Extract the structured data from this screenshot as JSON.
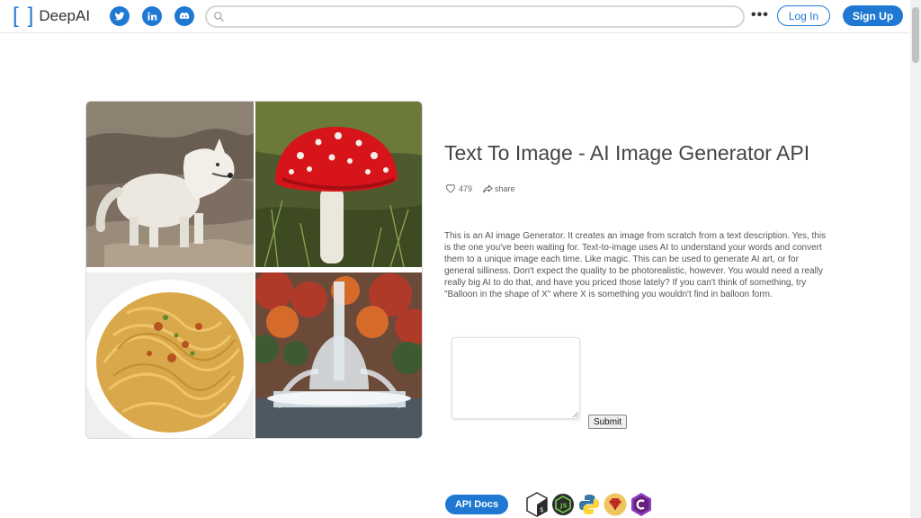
{
  "header": {
    "logo_text": "DeepAI",
    "search": {
      "placeholder": "",
      "value": ""
    },
    "more_label": "•••",
    "login_label": "Log In",
    "signup_label": "Sign Up",
    "social_icons": [
      "twitter-icon",
      "linkedin-icon",
      "discord-icon"
    ]
  },
  "gallery": {
    "images": [
      "white wolf on rocks",
      "red fly agaric mushroom",
      "spaghetti pasta dish",
      "water fountain with autumn trees"
    ]
  },
  "main": {
    "title": "Text To Image - AI Image Generator API",
    "likes": "479",
    "share_label": "share",
    "description": "This is an AI image Generator. It creates an image from scratch from a text description. Yes, this is the one you've been waiting for. Text-to-image uses AI to understand your words and convert them to a unique image each time. Like magic. This can be used to generate AI art, or for general silliness. Don't expect the quality to be photorealistic, however. You would need a really really big AI to do that, and have you priced those lately? If you can't think of something, try \"Balloon in the shape of X\" where X is something you wouldn't find in balloon form.",
    "prompt_value": "",
    "submit_label": "Submit"
  },
  "footer": {
    "api_docs_label": "API Docs",
    "language_icons": [
      "shell-icon",
      "nodejs-icon",
      "python-icon",
      "ruby-icon",
      "csharp-icon"
    ]
  },
  "colors": {
    "accent": "#1f78d1",
    "text": "#444444"
  }
}
